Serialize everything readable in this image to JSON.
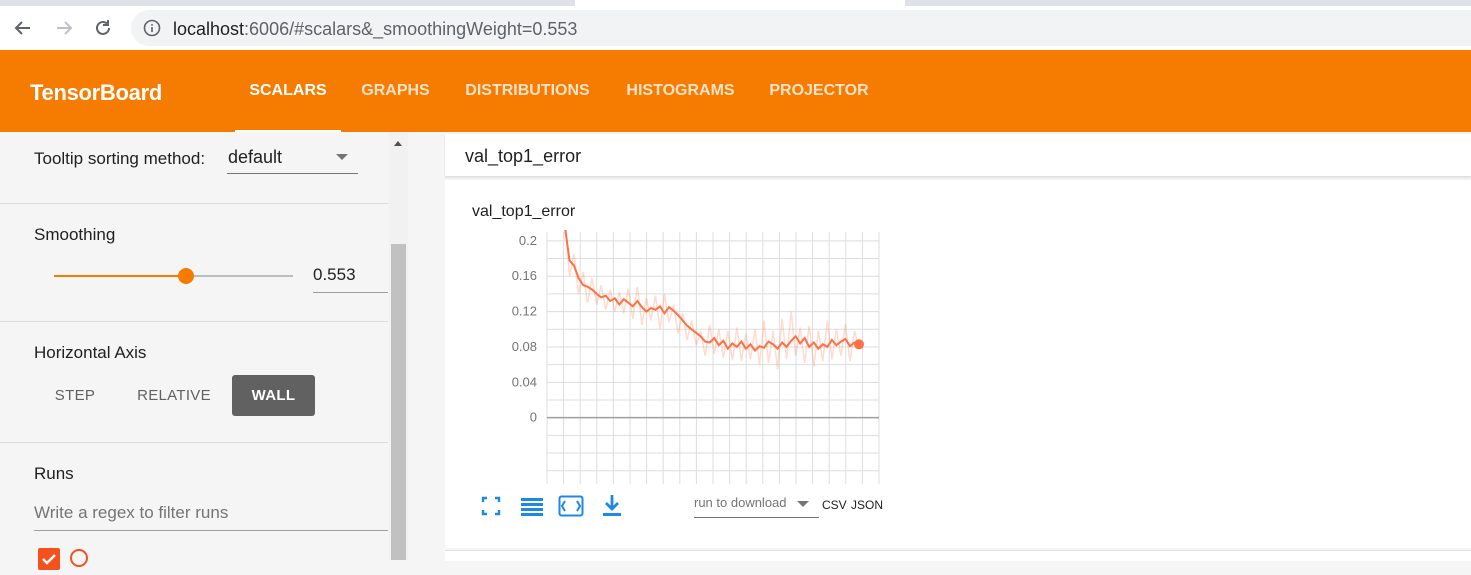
{
  "browser": {
    "url_host": "localhost",
    "url_rest": ":6006/#scalars&_smoothingWeight=0.553",
    "icons": [
      "back-arrow-icon",
      "forward-arrow-icon",
      "reload-icon",
      "info-icon"
    ]
  },
  "app": {
    "title": "TensorBoard",
    "accent_color": "#f57c00",
    "tabs": [
      {
        "label": "SCALARS",
        "active": true
      },
      {
        "label": "GRAPHS",
        "active": false
      },
      {
        "label": "DISTRIBUTIONS",
        "active": false
      },
      {
        "label": "HISTOGRAMS",
        "active": false
      },
      {
        "label": "PROJECTOR",
        "active": false
      }
    ]
  },
  "sidebar": {
    "tooltip_sorting": {
      "label": "Tooltip sorting method:",
      "value": "default"
    },
    "smoothing": {
      "label": "Smoothing",
      "value": "0.553",
      "fraction": 0.553
    },
    "horizontal_axis": {
      "label": "Horizontal Axis",
      "options": [
        {
          "label": "STEP",
          "selected": false
        },
        {
          "label": "RELATIVE",
          "selected": false
        },
        {
          "label": "WALL",
          "selected": true
        }
      ]
    },
    "runs": {
      "label": "Runs",
      "filter_placeholder": "Write a regex to filter runs",
      "run_color": "#f4511e"
    }
  },
  "main": {
    "category_title": "val_top1_error",
    "card": {
      "title": "val_top1_error",
      "run_select_placeholder": "run to download",
      "download_links": [
        "CSV",
        "JSON"
      ],
      "icons": [
        "fullscreen-icon",
        "toggle-log-scale-icon",
        "fit-domain-icon",
        "download-icon"
      ]
    }
  },
  "chart_data": {
    "type": "line",
    "title": "val_top1_error",
    "xlabel": "",
    "ylabel": "",
    "y_ticks": [
      "0.2",
      "0.16",
      "0.12",
      "0.08",
      "0.04",
      "0"
    ],
    "ylim": [
      -0.075,
      0.21
    ],
    "grid": true,
    "line_color": "#ff7043",
    "series": [
      {
        "smoothed": [
          0.215,
          0.178,
          0.172,
          0.158,
          0.15,
          0.148,
          0.145,
          0.14,
          0.136,
          0.138,
          0.132,
          0.135,
          0.128,
          0.134,
          0.13,
          0.126,
          0.132,
          0.125,
          0.12,
          0.124,
          0.122,
          0.126,
          0.118,
          0.125,
          0.121,
          0.116,
          0.11,
          0.104,
          0.1,
          0.096,
          0.092,
          0.086,
          0.085,
          0.09,
          0.082,
          0.087,
          0.078,
          0.084,
          0.08,
          0.086,
          0.078,
          0.083,
          0.076,
          0.081,
          0.079,
          0.086,
          0.083,
          0.078,
          0.085,
          0.08,
          0.087,
          0.092,
          0.084,
          0.09,
          0.08,
          0.085,
          0.078,
          0.083,
          0.08,
          0.088,
          0.082,
          0.086,
          0.089,
          0.081,
          0.085,
          0.083
        ],
        "raw": [
          0.23,
          0.16,
          0.185,
          0.14,
          0.165,
          0.13,
          0.158,
          0.128,
          0.15,
          0.122,
          0.145,
          0.12,
          0.142,
          0.118,
          0.146,
          0.112,
          0.148,
          0.105,
          0.135,
          0.11,
          0.138,
          0.1,
          0.14,
          0.108,
          0.128,
          0.095,
          0.118,
          0.088,
          0.11,
          0.082,
          0.098,
          0.07,
          0.105,
          0.072,
          0.1,
          0.068,
          0.098,
          0.065,
          0.102,
          0.064,
          0.095,
          0.066,
          0.1,
          0.06,
          0.11,
          0.062,
          0.098,
          0.055,
          0.112,
          0.066,
          0.12,
          0.07,
          0.102,
          0.062,
          0.104,
          0.058,
          0.098,
          0.064,
          0.11,
          0.066,
          0.1,
          0.07,
          0.106,
          0.064,
          0.098,
          0.08
        ]
      }
    ]
  }
}
